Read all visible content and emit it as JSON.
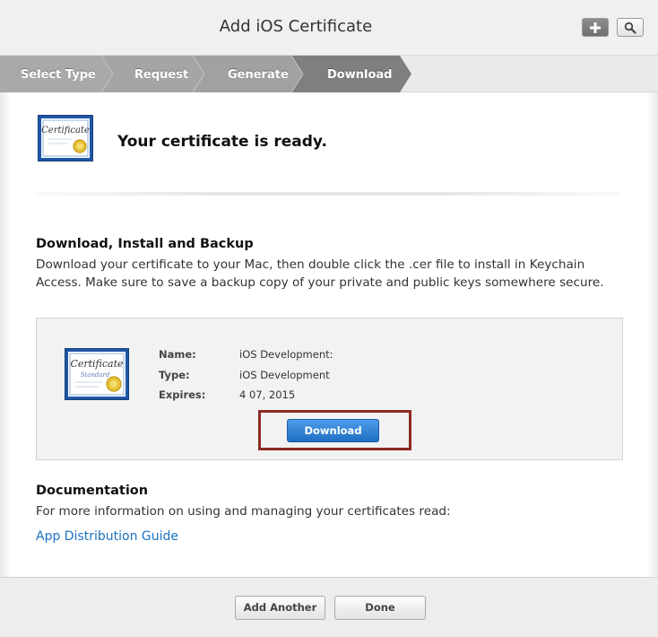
{
  "header": {
    "title": "Add iOS Certificate",
    "add_icon": "plus-icon",
    "search_icon": "search-icon"
  },
  "steps": [
    {
      "label": "Select Type"
    },
    {
      "label": "Request"
    },
    {
      "label": "Generate"
    },
    {
      "label": "Download",
      "active": true
    }
  ],
  "hero": {
    "certificate_script": "Certificate",
    "message": "Your certificate is ready."
  },
  "install": {
    "heading": "Download, Install and Backup",
    "line1": "Download your certificate to your Mac, then double click the .cer file to install in Keychain",
    "line2": "Access. Make sure to save a backup copy of your private and public keys somewhere secure."
  },
  "certificate": {
    "image_title": "Certificate",
    "image_subtitle": "Standard",
    "name_label": "Name:",
    "name_value": "iOS Development:",
    "type_label": "Type:",
    "type_value": "iOS Development",
    "expires_label": "Expires:",
    "expires_value": "4 07, 2015",
    "download_label": "Download"
  },
  "documentation": {
    "heading": "Documentation",
    "text": "For more information on using and managing your certificates read:",
    "link": "App Distribution Guide"
  },
  "footer": {
    "add_another_label": "Add Another",
    "done_label": "Done"
  },
  "colors": {
    "accent_blue": "#1e6fc4",
    "highlight_red": "#8e2a22",
    "link_blue": "#1a73c0",
    "step_gray": "#a7a7a7",
    "step_active": "#7d7d7d"
  }
}
